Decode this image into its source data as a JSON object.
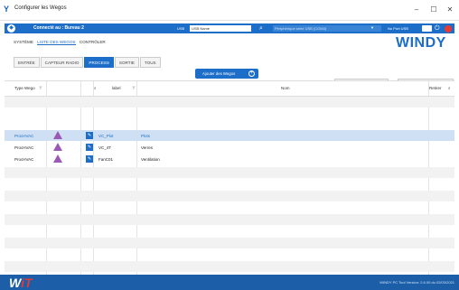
{
  "window": {
    "title": "Configurer les Wegos",
    "app_icon": "Y"
  },
  "topbar": {
    "connection": "Connecté au : Bureau 2",
    "usb_label": "USB",
    "usb_value": "USB Name",
    "port_placeholder": "Périphérique série USB (COM4)",
    "no_port": "No Port USB"
  },
  "brand": {
    "name": "WINDY"
  },
  "nav": {
    "items": [
      "SYSTÈME",
      "LISTE DES WEGOS",
      "CONTRÔLER"
    ]
  },
  "tabs": [
    "ENTRÉE",
    "CAPTEUR RADIO",
    "PROCESS",
    "SORTIE",
    "TOUS"
  ],
  "actions": {
    "add_label": "Ajouter des Wegos",
    "apply_label": "Appliquer",
    "refresh_label": "Rafraîchir"
  },
  "table": {
    "headers": {
      "type": "Type Wego",
      "label": "label",
      "name": "Nom",
      "remove": "Retirer"
    },
    "rows": [
      {
        "type": "ProcHVAC",
        "label": "VC_Plot",
        "name": "Plots"
      },
      {
        "type": "ProcHVAC",
        "label": "VC_4T",
        "name": "Verres"
      },
      {
        "type": "ProcHVAC",
        "label": "FanC01",
        "name": "Ventilation"
      }
    ]
  },
  "footer": {
    "logo_a": "W",
    "logo_b": "iT",
    "version": "WINDY PC Tool Version: 2.6.00 du 02/03/2021"
  },
  "colors": {
    "accent": "#1c6ec9",
    "purple": "#9b59b6",
    "stop": "#e53935"
  }
}
